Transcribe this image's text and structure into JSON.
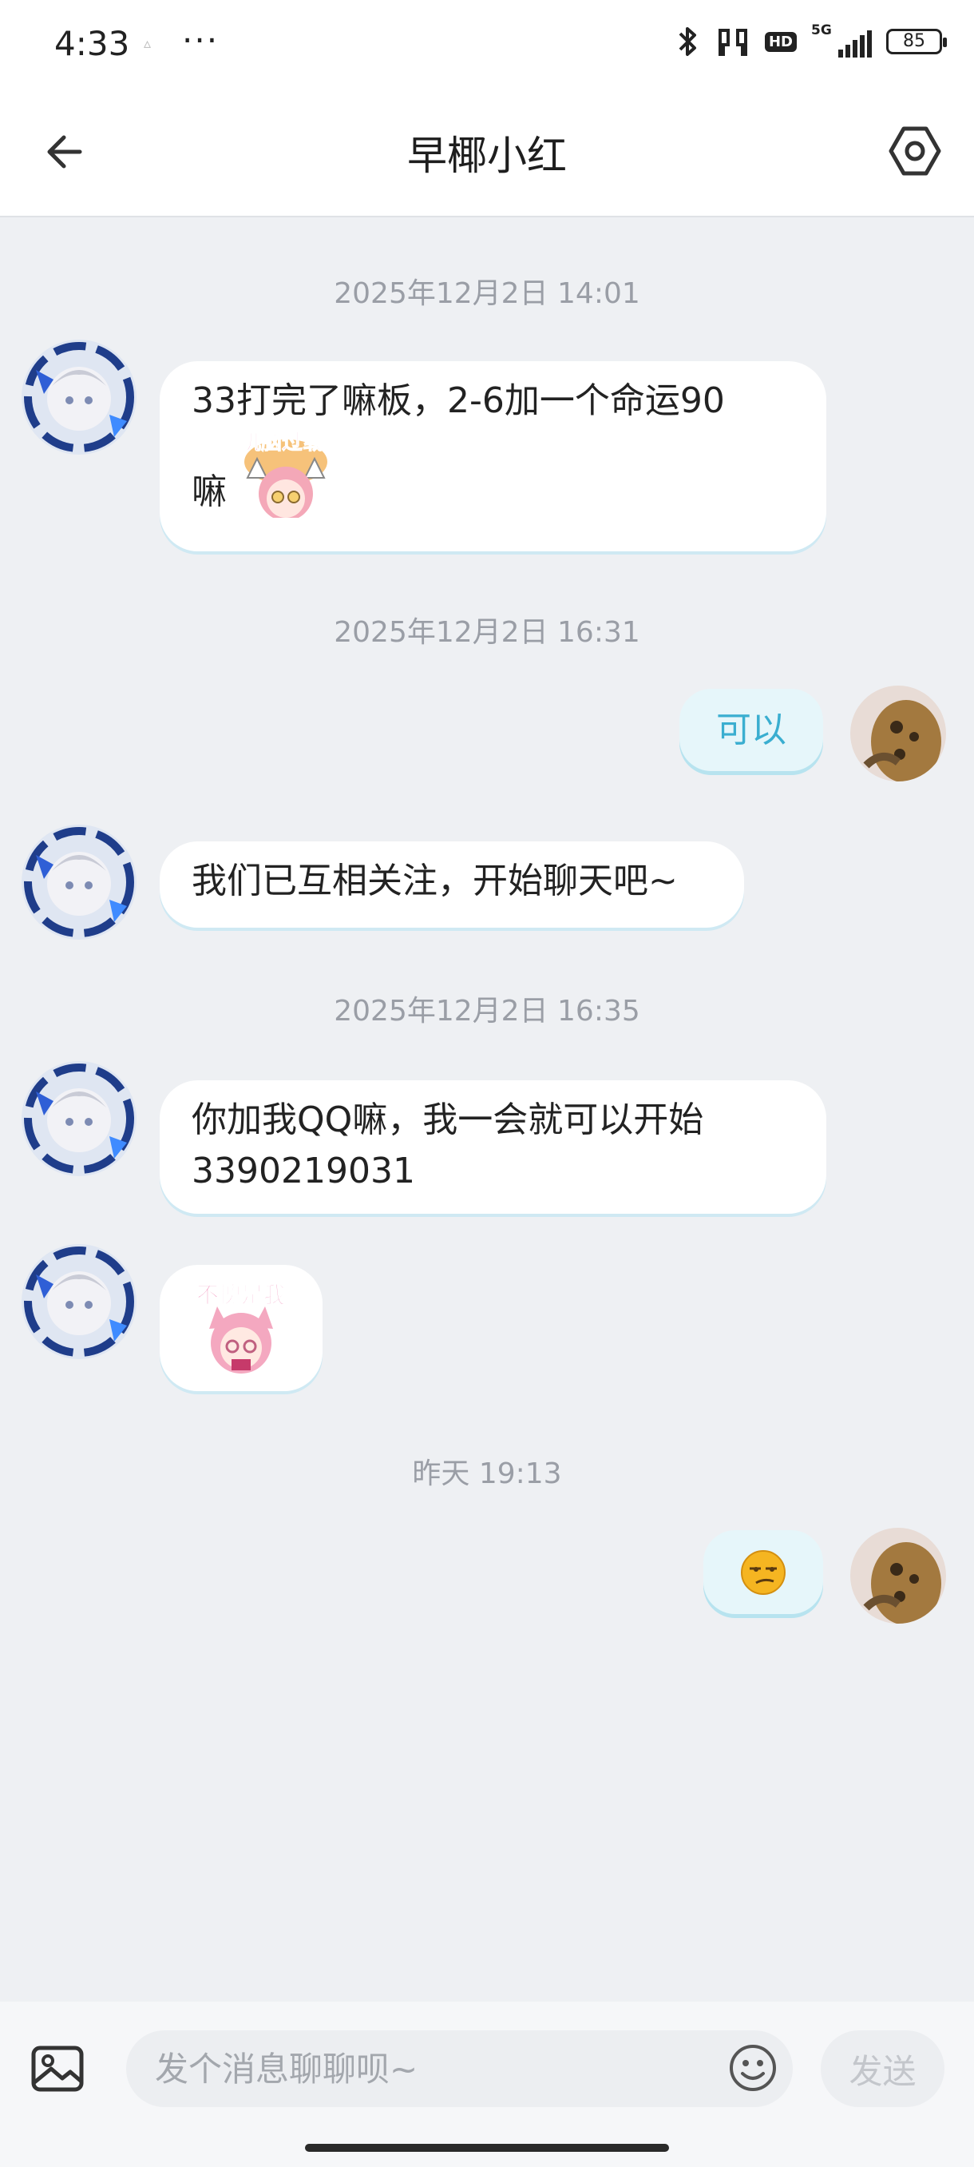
{
  "status_bar": {
    "time": "4:33",
    "dots": "···",
    "network": "5G",
    "hd_label": "HD",
    "battery": "85"
  },
  "header": {
    "title": "早椰小红"
  },
  "messages": [
    {
      "timestamp": "2025年12月2日 14:01"
    },
    {
      "from": "other",
      "text_line1": "33打完了嘛板，2-6加一个命运90",
      "text_line2": "嘛",
      "sticker_text": "叽脑过载"
    },
    {
      "timestamp": "2025年12月2日 16:31"
    },
    {
      "from": "me",
      "text": "可以"
    },
    {
      "from": "other",
      "text": "我们已互相关注，开始聊天吧~"
    },
    {
      "timestamp": "2025年12月2日 16:35"
    },
    {
      "from": "other",
      "text_line1": "你加我QQ嘛，我一会就可以开始",
      "text_line2": "3390219031"
    },
    {
      "from": "other",
      "sticker_text": "不愧是我"
    },
    {
      "timestamp": "昨天 19:13"
    },
    {
      "from": "me",
      "emoji": "smirk-emoji"
    }
  ],
  "input_bar": {
    "placeholder": "发个消息聊聊呗~",
    "send_label": "发送"
  },
  "icons": {
    "back": "back-arrow-icon",
    "settings": "hexagon-settings-icon",
    "image": "image-icon",
    "emoji": "emoji-icon"
  },
  "colors": {
    "accent": "#3aaed0",
    "self_bubble": "#e6f6fa",
    "background": "#eef0f3"
  }
}
